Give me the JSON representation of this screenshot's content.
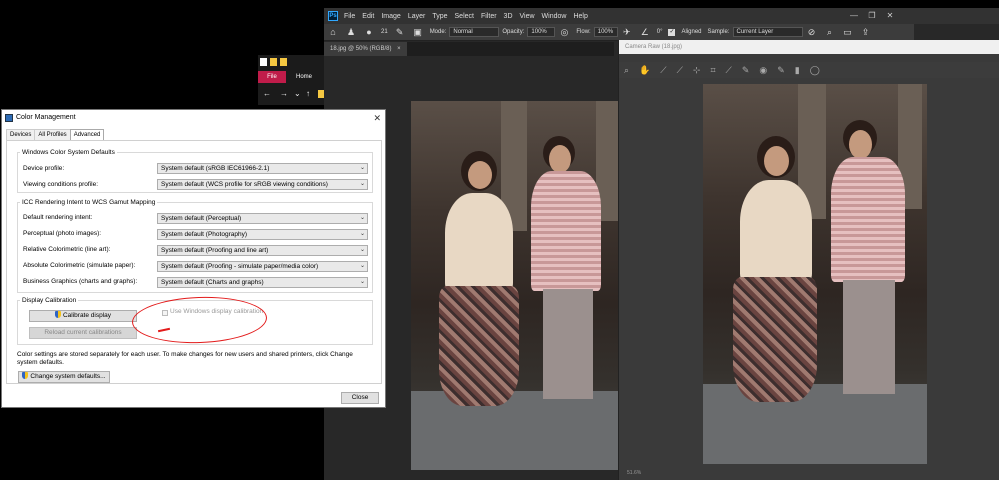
{
  "photoshop": {
    "menus": [
      "File",
      "Edit",
      "Image",
      "Layer",
      "Type",
      "Select",
      "Filter",
      "3D",
      "View",
      "Window",
      "Help"
    ],
    "options": {
      "brush_size": "21",
      "mode_label": "Mode:",
      "mode_value": "Normal",
      "opacity_label": "Opacity:",
      "opacity_value": "100%",
      "flow_label": "Flow:",
      "flow_value": "100%",
      "angle_value": "0°",
      "aligned_label": "Aligned",
      "sample_label": "Sample:",
      "sample_value": "Current Layer"
    },
    "document_tab": "18.jpg @ 50% (RGB/8)"
  },
  "camera_raw": {
    "title": "Camera Raw (18.jpg)",
    "zoom_status": "51.6%"
  },
  "explorer": {
    "file_tab": "File",
    "home_tab": "Home"
  },
  "color_management": {
    "title": "Color Management",
    "tabs": [
      "Devices",
      "All Profiles",
      "Advanced"
    ],
    "active_tab": "Advanced",
    "wcs_group": {
      "legend": "Windows Color System Defaults",
      "rows": [
        {
          "label": "Device profile:",
          "value": "System default (sRGB IEC61966-2.1)"
        },
        {
          "label": "Viewing conditions profile:",
          "value": "System default (WCS profile for sRGB viewing conditions)"
        }
      ]
    },
    "icc_group": {
      "legend": "ICC Rendering Intent to WCS Gamut Mapping",
      "rows": [
        {
          "label": "Default rendering intent:",
          "value": "System default (Perceptual)"
        },
        {
          "label": "Perceptual (photo images):",
          "value": "System default (Photography)"
        },
        {
          "label": "Relative Colorimetric (line art):",
          "value": "System default (Proofing and line art)"
        },
        {
          "label": "Absolute Colorimetric (simulate paper):",
          "value": "System default (Proofing - simulate paper/media color)"
        },
        {
          "label": "Business Graphics (charts and graphs):",
          "value": "System default (Charts and graphs)"
        }
      ]
    },
    "calibration_group": {
      "legend": "Display Calibration",
      "calibrate_button": "Calibrate display",
      "reload_button": "Reload current calibrations",
      "use_calibration_label": "Use Windows display calibration",
      "use_calibration_checked": false
    },
    "footer_text": "Color settings are stored separately for each user. To make changes for new users and shared printers, click Change system defaults.",
    "change_defaults_button": "Change system defaults...",
    "close_button": "Close",
    "annotation_color": "#e31b1b"
  }
}
